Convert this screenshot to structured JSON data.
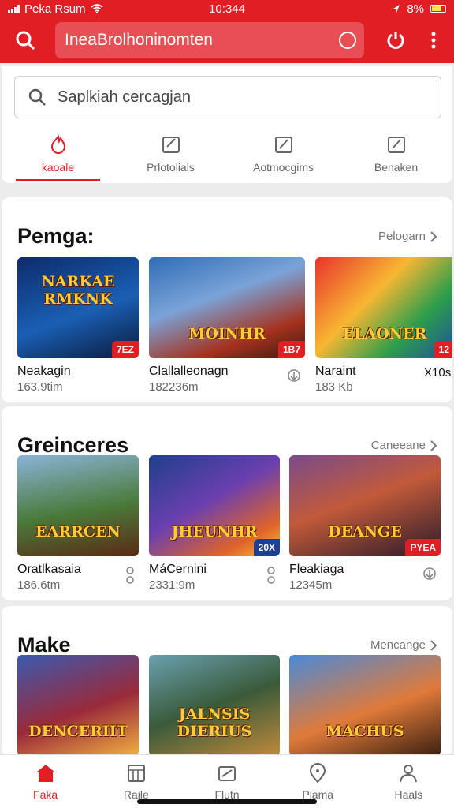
{
  "status": {
    "carrier": "Peka Rsum",
    "time": "10:344",
    "battery": "8%"
  },
  "appbar": {
    "title": "IneaBrolhoninomten"
  },
  "search": {
    "placeholder": "Saplkiah cercagjan"
  },
  "tabs": [
    {
      "label": "kaoale",
      "icon": "flame-icon"
    },
    {
      "label": "Prlotolials",
      "icon": "edit-icon"
    },
    {
      "label": "Aotmocgims",
      "icon": "edit-icon"
    },
    {
      "label": "Benaken",
      "icon": "edit-icon"
    }
  ],
  "sections": [
    {
      "title": "Pemga:",
      "link": "Pelogarn",
      "items": [
        {
          "name": "Neakagin",
          "size": "163.9tim",
          "badge": "7EZ",
          "art": "NARKAE RMKNK"
        },
        {
          "name": "Clallalleonagn",
          "size": "182236m",
          "badge": "1B7",
          "art": "MOINHR"
        },
        {
          "name": "Naraint",
          "size": "183 Kb",
          "badge": "12",
          "art": "ELAONER",
          "extra": "X10s"
        }
      ]
    },
    {
      "title": "Greinceres",
      "link": "Caneeane",
      "items": [
        {
          "name": "Oratlkasaia",
          "size": "186.6tm",
          "art": "EARRCEN"
        },
        {
          "name": "MáCernini",
          "size": "2331:9m",
          "badge": "20X",
          "art": "JHEUNHR"
        },
        {
          "name": "Fleakiaga",
          "size": "12345m",
          "badge": "PYEA",
          "art": "DEANGE"
        }
      ]
    },
    {
      "title": "Make",
      "link": "Mencange",
      "items": [
        {
          "art": "DENCERIIT"
        },
        {
          "art": "JALNSIS DIERIUS"
        },
        {
          "art": "MACHUS"
        }
      ]
    }
  ],
  "bottomnav": [
    {
      "label": "Faka",
      "icon": "home-icon"
    },
    {
      "label": "Raile",
      "icon": "calendar-icon"
    },
    {
      "label": "Flutn",
      "icon": "folder-icon"
    },
    {
      "label": "Plama",
      "icon": "location-icon"
    },
    {
      "label": "Haals",
      "icon": "profile-icon"
    }
  ],
  "colors": {
    "accent": "#e01e24"
  }
}
